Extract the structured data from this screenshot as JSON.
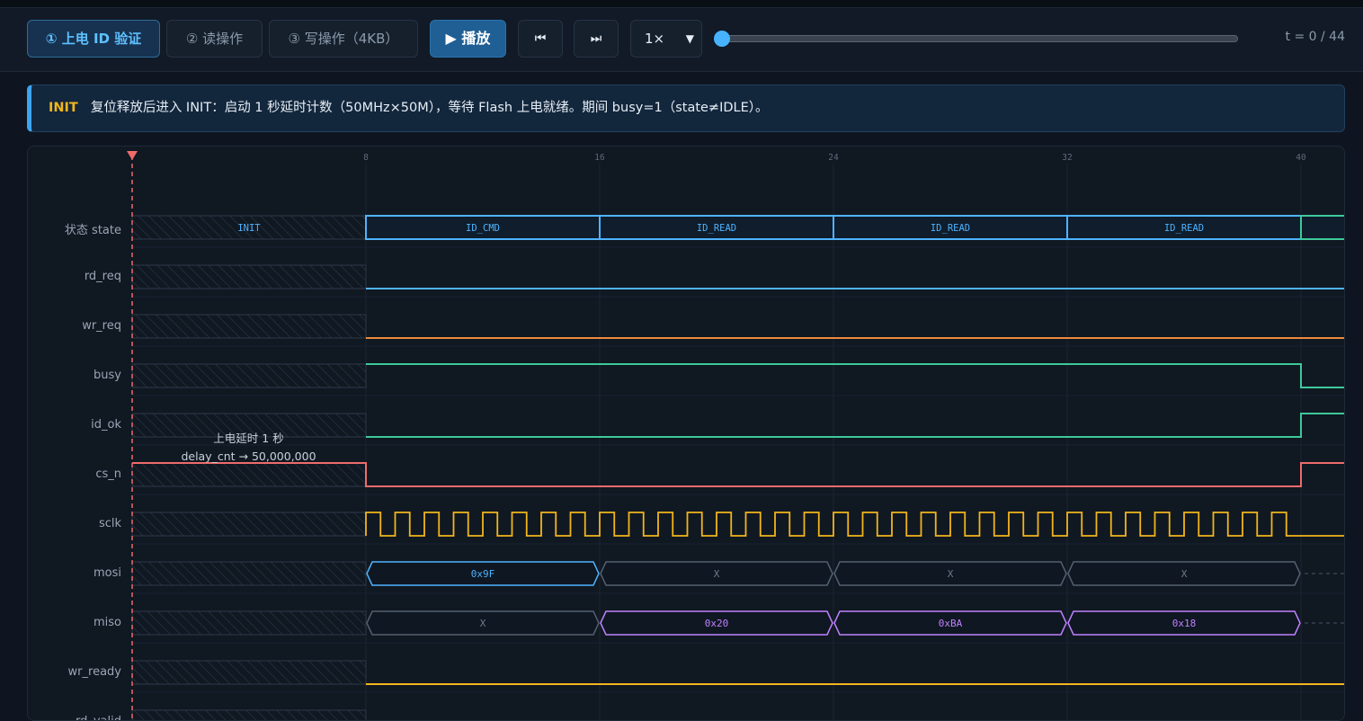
{
  "tabs": [
    {
      "label": "① 上电 ID 验证",
      "active": true
    },
    {
      "label": "② 读操作",
      "active": false
    },
    {
      "label": "③ 写操作（4KB）",
      "active": false
    }
  ],
  "controls": {
    "play_label": "▶ 播放",
    "rewind_icon": "⏮",
    "step_icon": "⏭",
    "speed_value": "1×",
    "t_prefix": "t = ",
    "t_current": "0",
    "t_sep": " / ",
    "t_total": "44"
  },
  "description": {
    "tag": "INIT",
    "text": "复位释放后进入 INIT：启动 1 秒延时计数（50MHz×50M），等待 Flash 上电就绪。期间 busy=1（state≠IDLE）。"
  },
  "colors": {
    "state": "#4fb3ff",
    "rd_req": "#4fb3ff",
    "wr_req": "#f08a3c",
    "busy": "#3ec99a",
    "id_ok": "#3ec99a",
    "cs_n": "#ef6b6b",
    "sclk": "#f2b61c",
    "mosi_active": "#4fb3ff",
    "miso_active": "#c080ff",
    "bus_x": "#53606f",
    "wr_ready": "#f2b61c",
    "cursor": "#ef6b6b"
  },
  "timeline": {
    "total_cycles": 44,
    "cursor": 0,
    "shaded_until": 8,
    "tick_labels": [
      "8",
      "16",
      "24",
      "32",
      "40"
    ],
    "tick_values": [
      8,
      16,
      24,
      32,
      40
    ]
  },
  "signals": [
    {
      "name": "状态 state"
    },
    {
      "name": "rd_req"
    },
    {
      "name": "wr_req"
    },
    {
      "name": "busy"
    },
    {
      "name": "id_ok"
    },
    {
      "name": "cs_n"
    },
    {
      "name": "sclk"
    },
    {
      "name": "mosi"
    },
    {
      "name": "miso"
    },
    {
      "name": "wr_ready"
    },
    {
      "name": "rd_valid"
    }
  ],
  "state_segments": [
    {
      "label": "INIT",
      "start": 0,
      "end": 8
    },
    {
      "label": "ID_CMD",
      "start": 8,
      "end": 16
    },
    {
      "label": "ID_READ",
      "start": 16,
      "end": 24
    },
    {
      "label": "ID_READ",
      "start": 24,
      "end": 32
    },
    {
      "label": "ID_READ",
      "start": 32,
      "end": 40
    },
    {
      "label": "",
      "start": 40,
      "end": 44
    }
  ],
  "levels": {
    "rd_req": [
      [
        8,
        0
      ]
    ],
    "wr_req": [
      [
        8,
        0
      ]
    ],
    "busy": [
      [
        8,
        1
      ],
      [
        40,
        0
      ]
    ],
    "id_ok": [
      [
        8,
        0
      ],
      [
        40,
        1
      ]
    ],
    "cs_n": [
      [
        0,
        1
      ],
      [
        8,
        0
      ],
      [
        40,
        1
      ]
    ],
    "wr_ready": [
      [
        8,
        0
      ]
    ]
  },
  "sclk": {
    "start": 8,
    "end": 40,
    "idle": 0
  },
  "mosi_segments": [
    {
      "label": "0x9F",
      "start": 8,
      "end": 16,
      "active": true
    },
    {
      "label": "X",
      "start": 16,
      "end": 24,
      "active": false
    },
    {
      "label": "X",
      "start": 24,
      "end": 32,
      "active": false
    },
    {
      "label": "X",
      "start": 32,
      "end": 40,
      "active": false
    }
  ],
  "miso_segments": [
    {
      "label": "X",
      "start": 8,
      "end": 16,
      "active": false
    },
    {
      "label": "0x20",
      "start": 16,
      "end": 24,
      "active": true
    },
    {
      "label": "0xBA",
      "start": 24,
      "end": 32,
      "active": true
    },
    {
      "label": "0x18",
      "start": 32,
      "end": 40,
      "active": true
    }
  ],
  "overlay": {
    "line1": "上电延时 1 秒",
    "line2": "delay_cnt → 50,000,000"
  }
}
